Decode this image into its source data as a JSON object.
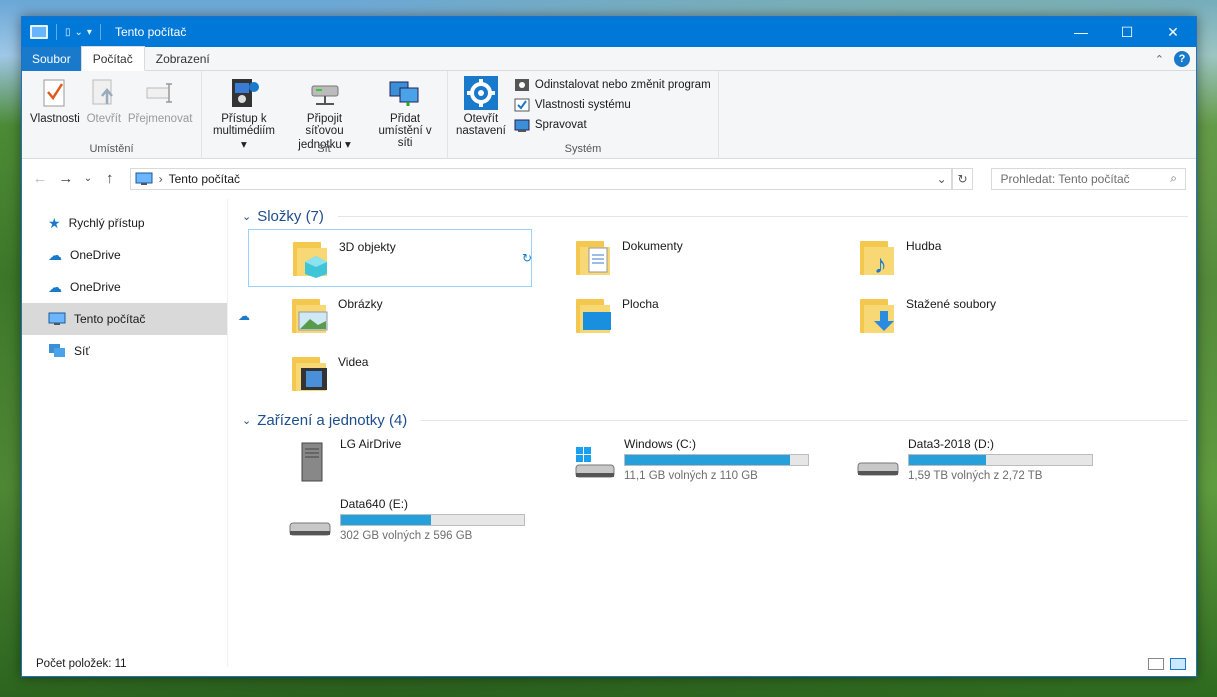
{
  "window": {
    "title": "Tento počítač"
  },
  "menu": {
    "file": "Soubor",
    "tabs": [
      "Počítač",
      "Zobrazení"
    ]
  },
  "ribbon": {
    "location": {
      "label": "Umístění",
      "buttons": [
        "Vlastnosti",
        "Otevřít",
        "Přejmenovat"
      ]
    },
    "network": {
      "label": "Síť",
      "buttons": [
        {
          "line1": "Přístup k",
          "line2": "multimédiím ▾"
        },
        {
          "line1": "Připojit síťovou",
          "line2": "jednotku ▾"
        },
        {
          "line1": "Přidat",
          "line2": "umístění v síti"
        }
      ]
    },
    "system": {
      "label": "Systém",
      "open_settings": {
        "line1": "Otevřít",
        "line2": "nastavení"
      },
      "small": [
        "Odinstalovat nebo změnit program",
        "Vlastnosti systému",
        "Spravovat"
      ]
    }
  },
  "address": {
    "path": "Tento počítač",
    "separator": "›"
  },
  "search": {
    "placeholder": "Prohledat: Tento počítač"
  },
  "sidebar": {
    "items": [
      "Rychlý přístup",
      "OneDrive",
      "OneDrive",
      "Tento počítač",
      "Síť"
    ]
  },
  "folders": {
    "title": "Složky (7)",
    "items": [
      "3D objekty",
      "Dokumenty",
      "Hudba",
      "Obrázky",
      "Plocha",
      "Stažené soubory",
      "Videa"
    ]
  },
  "devices": {
    "title": "Zařízení a jednotky (4)",
    "items": [
      {
        "name": "LG AirDrive",
        "free": "",
        "fill": null
      },
      {
        "name": "Windows (C:)",
        "free": "11,1 GB volných z 110 GB",
        "fill": 0.9
      },
      {
        "name": "Data3-2018 (D:)",
        "free": "1,59 TB volných z 2,72 TB",
        "fill": 0.42
      },
      {
        "name": "Data640 (E:)",
        "free": "302 GB volných z 596 GB",
        "fill": 0.49
      }
    ]
  },
  "status": {
    "count": "Počet položek: 11"
  }
}
